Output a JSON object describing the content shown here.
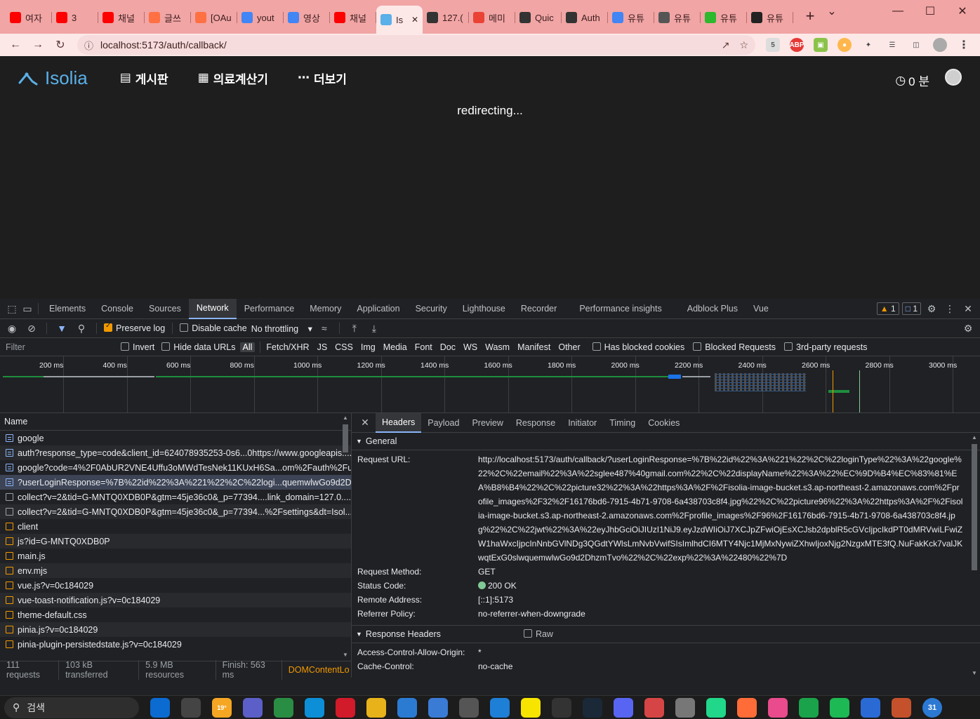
{
  "browser": {
    "tabs": [
      {
        "label": "여자",
        "icon": "youtube-icon",
        "color": "#ff0000"
      },
      {
        "label": "3",
        "icon": "youtube-icon",
        "color": "#ff0000"
      },
      {
        "label": "채널",
        "icon": "youtube-icon",
        "color": "#ff0000"
      },
      {
        "label": "글쓰",
        "icon": "t-logo-icon",
        "color": "#ff7043"
      },
      {
        "label": "[OAu",
        "icon": "t-logo-icon",
        "color": "#ff7043"
      },
      {
        "label": "yout",
        "icon": "google-icon",
        "color": "#4285f4"
      },
      {
        "label": "영상",
        "icon": "google-icon",
        "color": "#4285f4"
      },
      {
        "label": "채널",
        "icon": "youtube-icon",
        "color": "#ff0000"
      },
      {
        "label": "Is",
        "icon": "isolia-icon",
        "color": "#5ab0e8",
        "active": true
      },
      {
        "label": "127.(",
        "icon": "globe-icon",
        "color": "#333333"
      },
      {
        "label": "메미",
        "icon": "gmail-icon",
        "color": "#ea4335"
      },
      {
        "label": "Quic",
        "icon": "globe-icon",
        "color": "#333333"
      },
      {
        "label": "Auth",
        "icon": "globe-icon",
        "color": "#333333"
      },
      {
        "label": "유튜",
        "icon": "google-icon",
        "color": "#4285f4"
      },
      {
        "label": "유튜",
        "icon": "clapper-icon",
        "color": "#555555"
      },
      {
        "label": "유튜",
        "icon": "u-logo-icon",
        "color": "#2eb82e"
      },
      {
        "label": "유튜",
        "icon": "slash-icon",
        "color": "#222222"
      }
    ],
    "url": "localhost:5173/auth/callback/"
  },
  "app": {
    "logo": "Isolia",
    "nav": [
      "게시판",
      "의료계산기",
      "더보기"
    ],
    "time": "0 분",
    "message": "redirecting..."
  },
  "devtools": {
    "tabs": [
      "Elements",
      "Console",
      "Sources",
      "Network",
      "Performance",
      "Memory",
      "Application",
      "Security",
      "Lighthouse",
      "Recorder",
      "Performance insights",
      "Adblock Plus",
      "Vue"
    ],
    "active_tab": "Network",
    "warnings": "1",
    "messages": "1",
    "toolbar": {
      "preserve_log": "Preserve log",
      "disable_cache": "Disable cache",
      "throttling": "No throttling"
    },
    "filter": {
      "placeholder": "Filter",
      "invert": "Invert",
      "hide_data_urls": "Hide data URLs",
      "types": [
        "All",
        "Fetch/XHR",
        "JS",
        "CSS",
        "Img",
        "Media",
        "Font",
        "Doc",
        "WS",
        "Wasm",
        "Manifest",
        "Other"
      ],
      "has_blocked_cookies": "Has blocked cookies",
      "blocked_requests": "Blocked Requests",
      "third_party": "3rd-party requests"
    },
    "timeline_ticks": [
      "200 ms",
      "400 ms",
      "600 ms",
      "800 ms",
      "1000 ms",
      "1200 ms",
      "1400 ms",
      "1600 ms",
      "1800 ms",
      "2000 ms",
      "2200 ms",
      "2400 ms",
      "2600 ms",
      "2800 ms",
      "3000 ms"
    ],
    "name_header": "Name",
    "requests": [
      {
        "name": "google",
        "type": "doc"
      },
      {
        "name": "auth?response_type=code&client_id=624078935253-0s6...0https://www.googleapis....",
        "type": "doc"
      },
      {
        "name": "google?code=4%2F0AbUR2VNE4Uffu3oMWdTesNek11KUxH6Sa...om%2Fauth%2Fus...",
        "type": "doc"
      },
      {
        "name": "?userLoginResponse=%7B%22id%22%3A%221%22%2C%22logi...quemwlwGo9d2Dh...",
        "type": "doc",
        "selected": true
      },
      {
        "name": "collect?v=2&tid=G-MNTQ0XDB0P&gtm=45je36c0&_p=77394....link_domain=127.0....",
        "type": "blank"
      },
      {
        "name": "collect?v=2&tid=G-MNTQ0XDB0P&gtm=45je36c0&_p=77394...%2Fsettings&dt=Isol...",
        "type": "blank"
      },
      {
        "name": "client",
        "type": "js"
      },
      {
        "name": "js?id=G-MNTQ0XDB0P",
        "type": "js"
      },
      {
        "name": "main.js",
        "type": "js"
      },
      {
        "name": "env.mjs",
        "type": "js"
      },
      {
        "name": "vue.js?v=0c184029",
        "type": "js"
      },
      {
        "name": "vue-toast-notification.js?v=0c184029",
        "type": "js"
      },
      {
        "name": "theme-default.css",
        "type": "js"
      },
      {
        "name": "pinia.js?v=0c184029",
        "type": "js"
      },
      {
        "name": "pinia-plugin-persistedstate.js?v=0c184029",
        "type": "js"
      }
    ],
    "status": {
      "requests": "111 requests",
      "transferred": "103 kB transferred",
      "resources": "5.9 MB resources",
      "finish": "Finish: 563 ms",
      "dcl": "DOMContentLo"
    },
    "detail_tabs": [
      "Headers",
      "Payload",
      "Preview",
      "Response",
      "Initiator",
      "Timing",
      "Cookies"
    ],
    "general": {
      "title": "General",
      "rows": [
        {
          "k": "Request URL:",
          "v": "http://localhost:5173/auth/callback/?userLoginResponse=%7B%22id%22%3A%221%22%2C%22loginType%22%3A%22google%22%2C%22email%22%3A%22sglee487%40gmail.com%22%2C%22displayName%22%3A%22%EC%9D%B4%EC%83%81%EA%B8%B4%22%2C%22picture32%22%3A%22https%3A%2F%2Fisolia-image-bucket.s3.ap-northeast-2.amazonaws.com%2Fprofile_images%2F32%2F16176bd6-7915-4b71-9708-6a438703c8f4.jpg%22%2C%22picture96%22%3A%22https%3A%2F%2Fisolia-image-bucket.s3.ap-northeast-2.amazonaws.com%2Fprofile_images%2F96%2F16176bd6-7915-4b71-9708-6a438703c8f4.jpg%22%2C%22jwt%22%3A%22eyJhbGciOiJIUzI1NiJ9.eyJzdWIiOiJ7XCJpZFwiOjEsXCJsb2dpblR5cGVcIjpcIkdPT0dMRVwiLFwiZW1haWxcIjpcInNnbGVlNDg3QGdtYWlsLmNvbVwifSIsImlhdCI6MTY4Njc1MjMxNywiZXhwIjoxNjg2NzgxMTE3fQ.NuFakKck7valJKwqtExG0slwquemwlwGo9d2DhzmTvo%22%2C%22exp%22%3A%22480%22%7D"
        },
        {
          "k": "Request Method:",
          "v": "GET"
        },
        {
          "k": "Status Code:",
          "v": "200 OK"
        },
        {
          "k": "Remote Address:",
          "v": "[::1]:5173"
        },
        {
          "k": "Referrer Policy:",
          "v": "no-referrer-when-downgrade"
        }
      ]
    },
    "response_headers": {
      "title": "Response Headers",
      "raw": "Raw",
      "rows": [
        {
          "k": "Access-Control-Allow-Origin:",
          "v": "*"
        },
        {
          "k": "Cache-Control:",
          "v": "no-cache"
        }
      ]
    }
  },
  "taskbar": {
    "search": "검색",
    "weather": "19°",
    "calendar_badge": "31",
    "apps": [
      "copilot-icon",
      "file-explorer-icon",
      "weather-icon",
      "teams-icon",
      "chrome-icon",
      "edge-icon",
      "opera-icon",
      "folder-icon",
      "notepad-icon",
      "photos-icon",
      "calculator-icon",
      "vscode-icon",
      "kakaotalk-icon",
      "terminal-icon",
      "steam-icon",
      "discord-icon",
      "snipping-icon",
      "clock-icon",
      "pycharm-icon",
      "postman-icon",
      "intellij-icon",
      "app-icon",
      "spotify-icon",
      "clion-icon",
      "store-icon",
      "calendar-icon"
    ]
  }
}
